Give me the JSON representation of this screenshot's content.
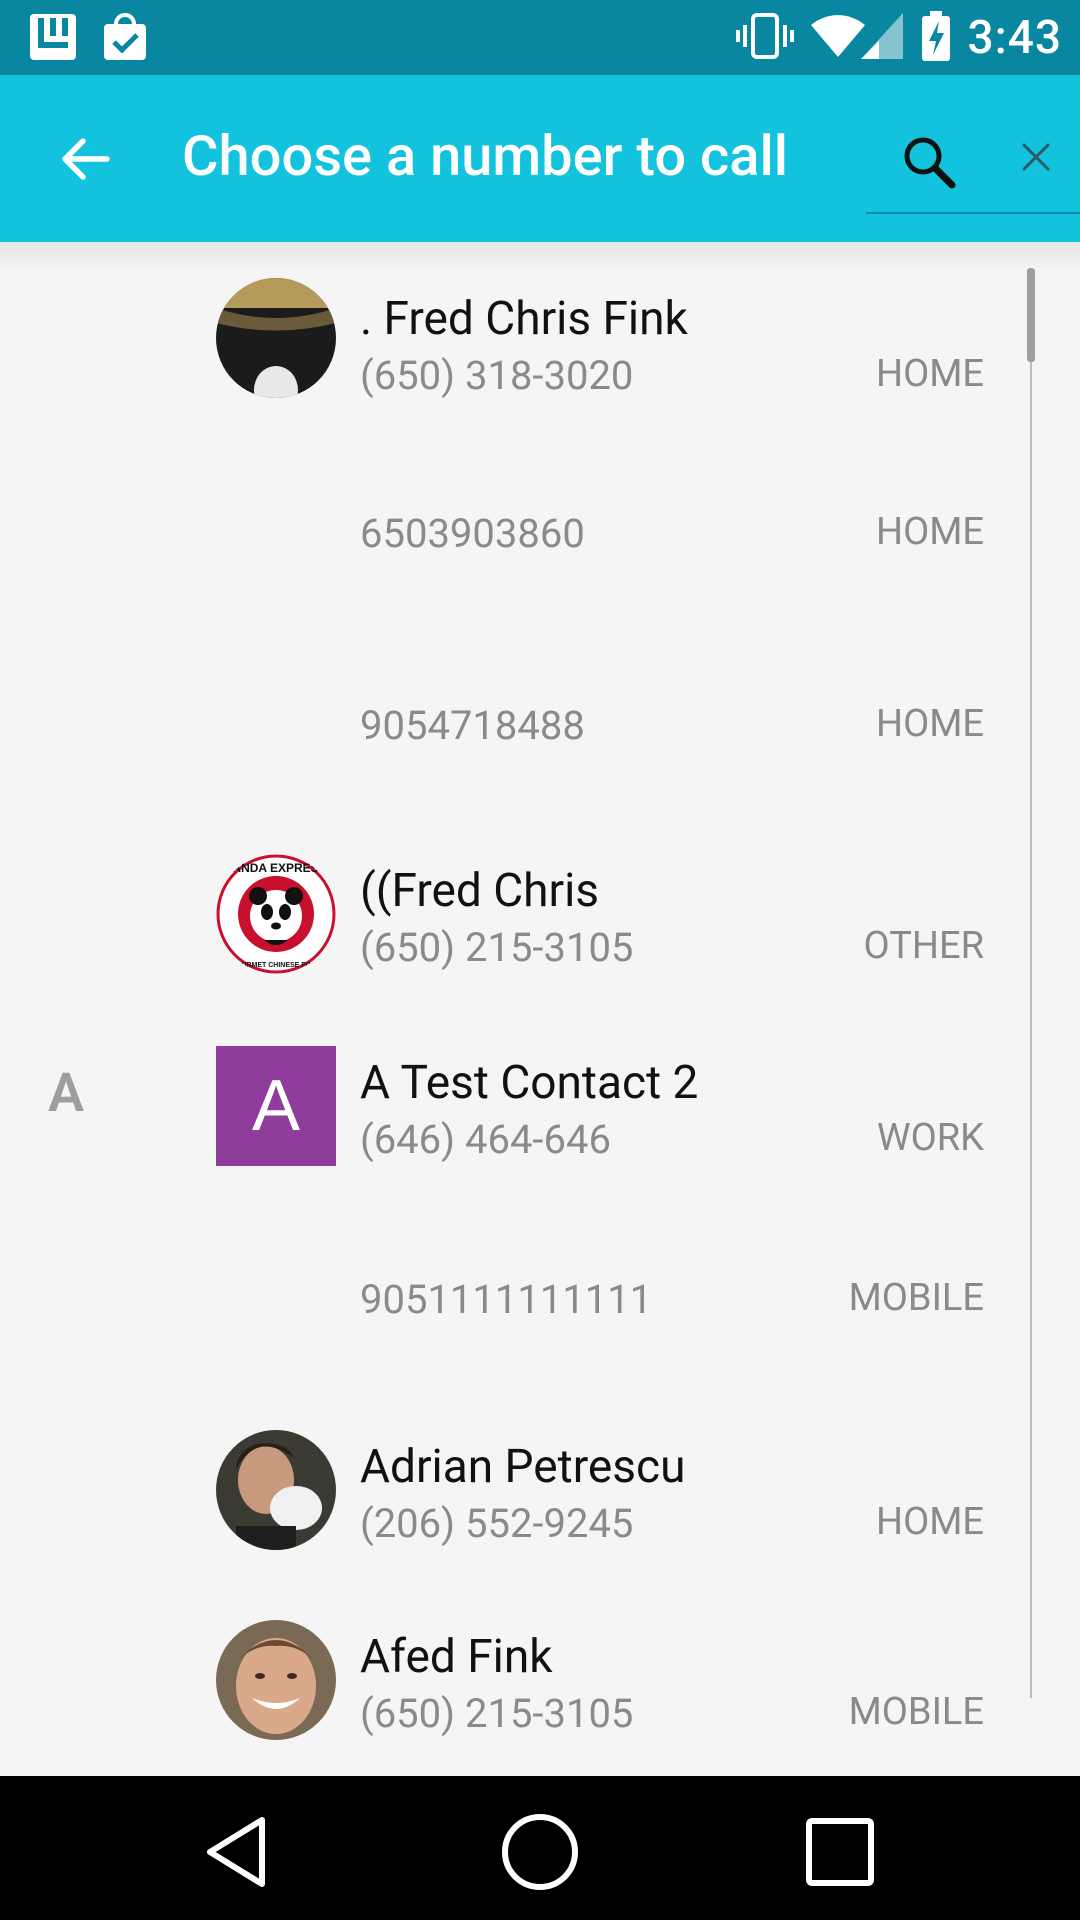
{
  "status_bar": {
    "time": "3:43",
    "left_icons": [
      "launcher-app-icon",
      "shopping-bag-check-icon"
    ],
    "right_icons": [
      "vibrate-icon",
      "wifi-icon",
      "cell-signal-icon",
      "battery-charging-icon"
    ]
  },
  "app_bar": {
    "title": "Choose a number to call",
    "back_icon": "arrow-back-icon",
    "search_icon": "search-icon",
    "close_icon": "close-icon",
    "background": "#13c3dd"
  },
  "contacts": [
    {
      "section": "",
      "name": ". Fred Chris Fink",
      "avatar": "photo",
      "numbers": [
        {
          "number": "(650) 318-3020",
          "type": "HOME"
        },
        {
          "number": "6503903860",
          "type": "HOME"
        },
        {
          "number": "9054718488",
          "type": "HOME"
        }
      ]
    },
    {
      "section": "",
      "name": "((Fred Chris",
      "avatar": "panda-express-logo",
      "logo_text": "PANDA EXPRESS",
      "logo_subtext": "GOURMET CHINESE FOOD",
      "numbers": [
        {
          "number": "(650) 215-3105",
          "type": "OTHER"
        }
      ]
    },
    {
      "section": "A",
      "name": "A Test Contact 2",
      "avatar": "letter",
      "avatar_letter": "A",
      "avatar_color": "#8e3d9b",
      "numbers": [
        {
          "number": "(646) 464-646",
          "type": "WORK"
        },
        {
          "number": "9051111111111",
          "type": "MOBILE"
        }
      ]
    },
    {
      "section": "",
      "name": "Adrian Petrescu",
      "avatar": "photo",
      "numbers": [
        {
          "number": "(206) 552-9245",
          "type": "HOME"
        }
      ]
    },
    {
      "section": "",
      "name": "Afed Fink",
      "avatar": "photo",
      "numbers": [
        {
          "number": "(650) 215-3105",
          "type": "MOBILE"
        }
      ]
    }
  ],
  "nav_bar": {
    "back_icon": "nav-back-icon",
    "home_icon": "nav-home-icon",
    "recents_icon": "nav-recents-icon"
  }
}
